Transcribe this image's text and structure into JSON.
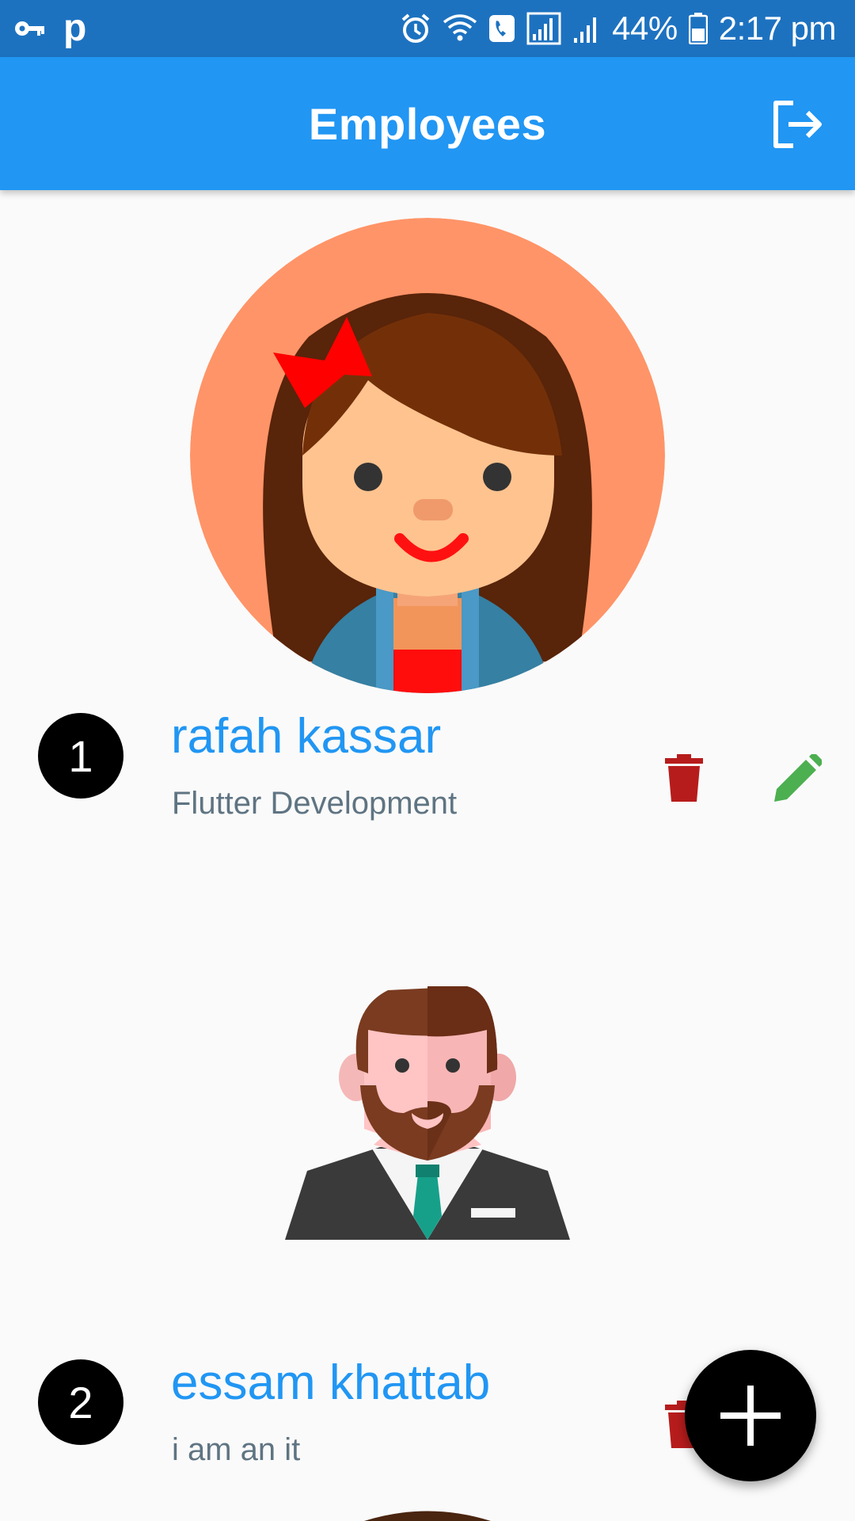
{
  "status_bar": {
    "battery": "44%",
    "time": "2:17 pm",
    "left_letter": "p"
  },
  "app_bar": {
    "title": "Employees",
    "action_icon": "logout-icon"
  },
  "employees": [
    {
      "number": "1",
      "name": "rafah kassar",
      "role": "Flutter Development",
      "avatar": "girl-avatar"
    },
    {
      "number": "2",
      "name": "essam khattab",
      "role": "i am an it",
      "avatar": "businessman-avatar"
    }
  ],
  "colors": {
    "status_bar": "#1d72c0",
    "app_bar": "#2196f3",
    "name_text": "#2196f3",
    "delete_icon": "#b71c1c",
    "edit_icon": "#4caf50",
    "fab": "#000000"
  },
  "fab": {
    "icon": "plus-icon"
  }
}
